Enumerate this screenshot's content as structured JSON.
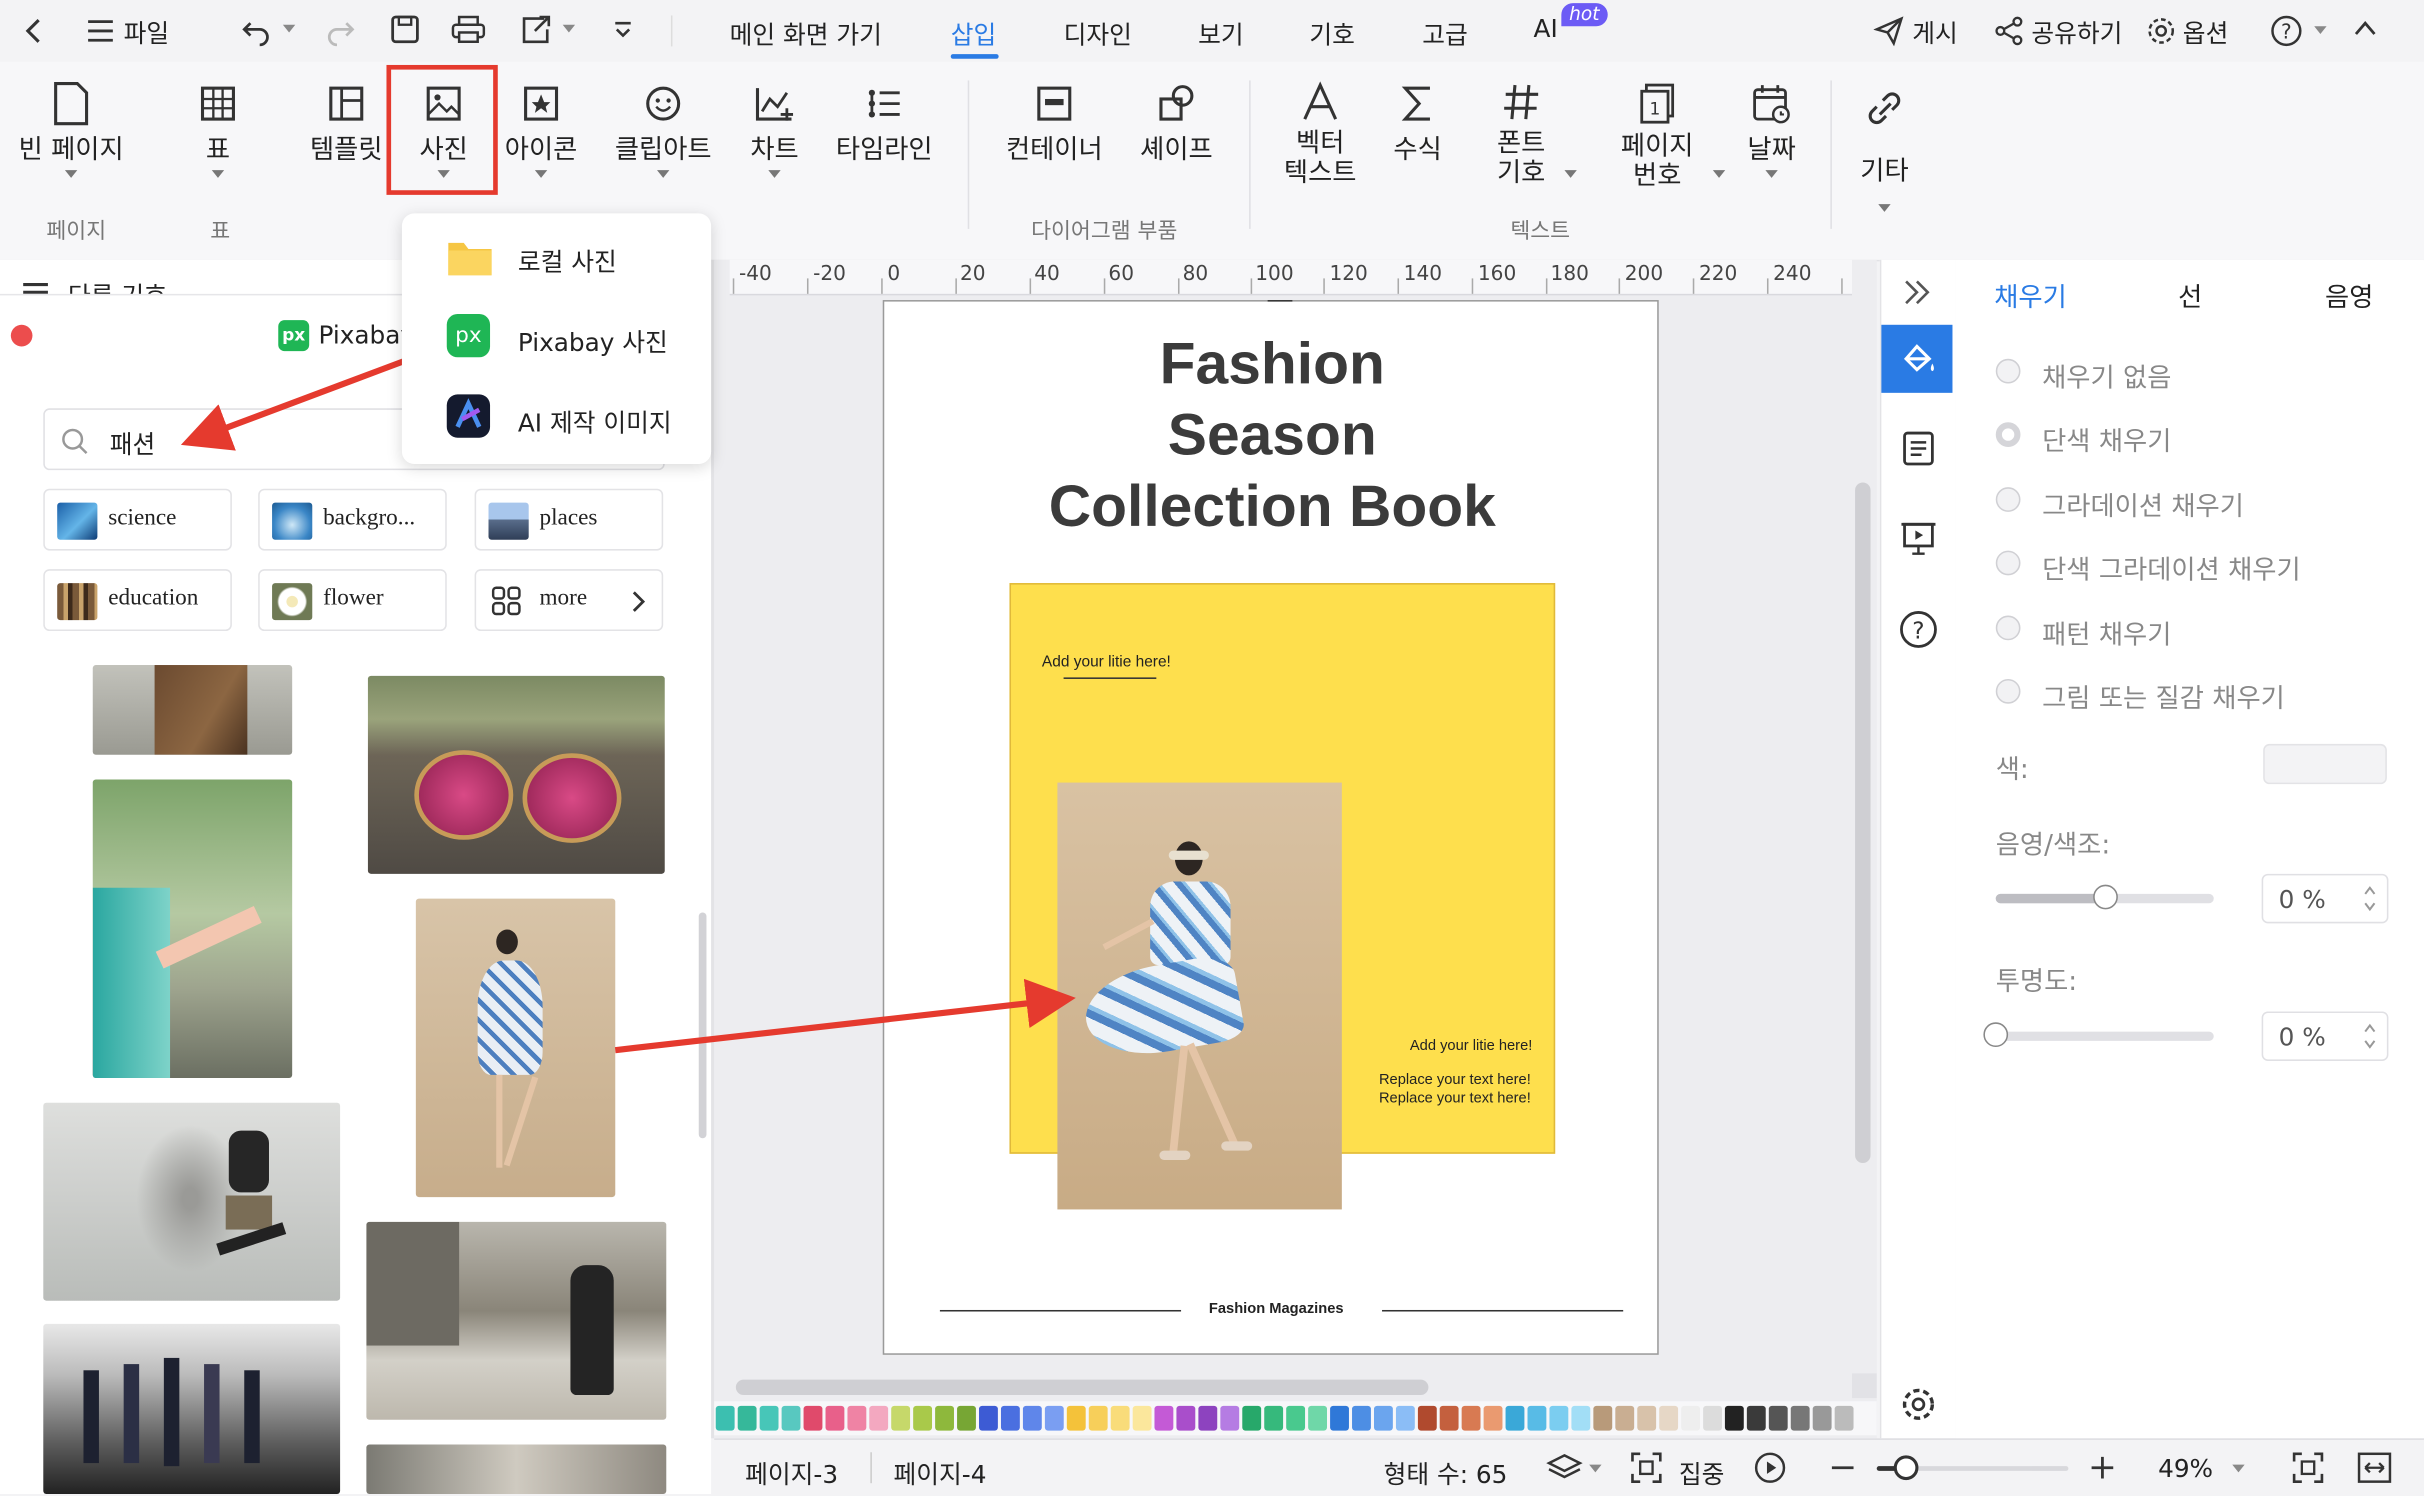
{
  "topbar": {
    "file": "파일",
    "menus": [
      "메인 화면 가기",
      "삽입",
      "디자인",
      "보기",
      "기호",
      "고급",
      "AI"
    ],
    "hot_badge": "hot",
    "publish": "게시",
    "share": "공유하기",
    "options": "옵션"
  },
  "ribbon": {
    "buttons": {
      "blank_page": "빈 페이지",
      "table": "표",
      "template": "템플릿",
      "photo": "사진",
      "icon": "아이콘",
      "clipart": "클립아트",
      "chart": "차트",
      "timeline": "타임라인",
      "container": "컨테이너",
      "shape": "셰이프",
      "vector_text_1": "벡터",
      "vector_text_2": "텍스트",
      "formula": "수식",
      "font_symbol_1": "폰트",
      "font_symbol_2": "기호",
      "page_number_1": "페이지",
      "page_number_2": "번호",
      "date": "날짜",
      "other": "기타"
    },
    "groups": {
      "page": "페이지",
      "table": "표",
      "diagram_parts": "다이어그램 부품",
      "text": "텍스트"
    }
  },
  "photo_menu": {
    "items": [
      "로컬 사진",
      "Pixabay 사진",
      "AI 제작 이미지"
    ]
  },
  "left_panel": {
    "header_partial": "다른 기호 -",
    "source": "Pixabay",
    "source_logo": "px",
    "search_value": "패션",
    "tags": [
      "science",
      "backgro...",
      "places",
      "education",
      "flower",
      "more"
    ]
  },
  "ruler": {
    "ticks": [
      "-40",
      "-20",
      "0",
      "20",
      "40",
      "60",
      "80",
      "100",
      "120",
      "140",
      "160",
      "180",
      "200",
      "220",
      "240"
    ]
  },
  "document": {
    "title_line1": "Fashion",
    "title_line2": "Season",
    "title_line3": "Collection Book",
    "card_title": "Add your litie here!",
    "card_title_2": "Add your litie here!",
    "card_body_1": "Replace your text here!",
    "card_body_2": "Replace your text here!",
    "footer": "Fashion Magazines",
    "accent_color": "#fedf4d"
  },
  "right_panel": {
    "tabs": [
      "채우기",
      "선",
      "음영"
    ],
    "fill_options": [
      "채우기 없음",
      "단색 채우기",
      "그라데이션 채우기",
      "단색 그라데이션 채우기",
      "패턴 채우기",
      "그림 또는 질감 채우기"
    ],
    "color_label": "색:",
    "shade_label": "음영/색조:",
    "shade_value": "0 %",
    "shade_level": 0.5,
    "transparency_label": "투명도:",
    "transparency_value": "0 %",
    "transparency_level": 0
  },
  "status": {
    "page_tabs": [
      "페이지-3",
      "페이지-4"
    ],
    "shape_count": "형태 수: 65",
    "focus": "집중",
    "zoom": "49%",
    "zoom_level": 0.15
  },
  "colors": {
    "accent": "#2a7be4",
    "highlight": "#e53a2e",
    "annotation_arrow": "#e53a2e"
  }
}
